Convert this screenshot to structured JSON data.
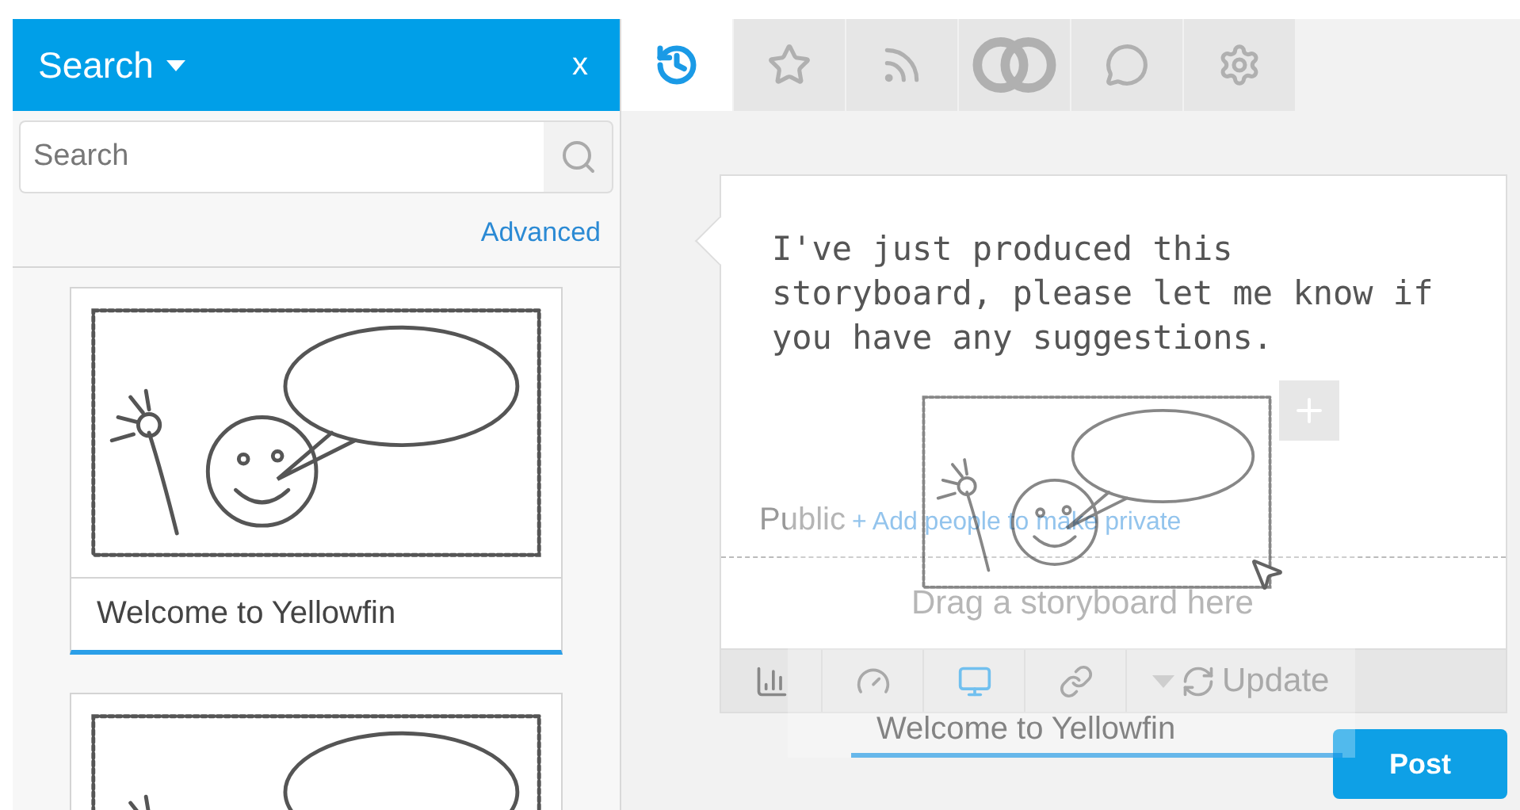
{
  "sidebar": {
    "title": "Search",
    "close": "x",
    "search": {
      "placeholder": "Search"
    },
    "advanced_link": "Advanced",
    "storyboards": [
      {
        "kind": "card",
        "title": "Welcome to Yellowfin"
      },
      {
        "kind": "thumbnail"
      }
    ]
  },
  "tabs": [
    {
      "selected": true
    },
    {
      "selected": false
    },
    {
      "selected": false
    },
    {
      "selected": false
    },
    {
      "selected": false
    },
    {
      "selected": false
    }
  ],
  "composer": {
    "message": "I've just produced this storyboard, please let me know if you have any suggestions.",
    "visibility": "Public",
    "add_people_link": "+ Add people to make private",
    "drop_hint": "Drag a storyboard here",
    "toolbar": [
      {
        "selected": false
      },
      {
        "selected": false
      },
      {
        "selected": true
      },
      {
        "selected": false
      }
    ],
    "update_button": "Update",
    "post_button": "Post"
  },
  "drag_preview": {
    "title": "Welcome to Yellowfin"
  }
}
